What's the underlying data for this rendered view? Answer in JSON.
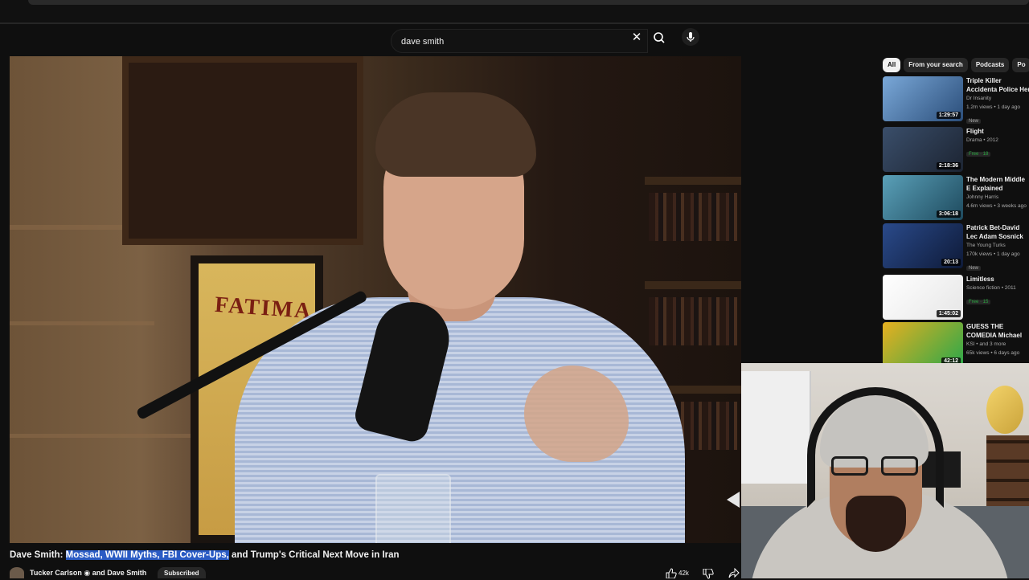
{
  "search": {
    "query": "dave smith"
  },
  "chips": [
    "All",
    "From your search",
    "Podcasts",
    "Po"
  ],
  "recommendations": [
    {
      "title": "Triple Killer Accidenta Police Her Horrifying",
      "channel": "Dr Insanity",
      "meta": "1.2m views • 1 day ago",
      "badge": "New",
      "duration": "1:29:57",
      "thumb_color": "#4a7ab0"
    },
    {
      "title": "Flight",
      "channel": "Drama • 2012",
      "meta": "",
      "badge": "Free · 18",
      "duration": "2:18:36",
      "thumb_color": "#2e3a4e"
    },
    {
      "title": "The Modern Middle E Explained",
      "channel": "Johnny Harris",
      "meta": "4.6m views • 3 weeks ago",
      "badge": "",
      "duration": "3:06:18",
      "thumb_color": "#3a6e86"
    },
    {
      "title": "Patrick Bet-David Lec Adam Sosnick For G",
      "channel": "The Young Turks",
      "meta": "170k views • 1 day ago",
      "badge": "New",
      "duration": "20:13",
      "thumb_color": "#1e3260"
    },
    {
      "title": "Limitless",
      "channel": "Science fiction • 2011",
      "meta": "",
      "badge": "Free · 15",
      "duration": "1:45:02",
      "thumb_color": "#f2f2f2"
    },
    {
      "title": "GUESS THE COMEDIA Michael McIntyre, Ste",
      "channel": "KSI • and 3 more",
      "meta": "65k views • 6 days ago",
      "badge": "",
      "duration": "42:12",
      "thumb_color": "#d8a020"
    }
  ],
  "video": {
    "title_before": "Dave Smith: ",
    "title_highlight": "Mossad, WWII Myths, FBI Cover-Ups,",
    "title_after": " and Trump's Critical Next Move in Iran",
    "channel": "Tucker Carlson ◉ and Dave Smith",
    "subscribe_label": "Subscribed",
    "likes": "42k",
    "poster_text": "FATIMA"
  },
  "colors": {
    "highlight": "#2a5bc4",
    "background": "#0f0f0f",
    "free_badge": "#2ba640"
  }
}
